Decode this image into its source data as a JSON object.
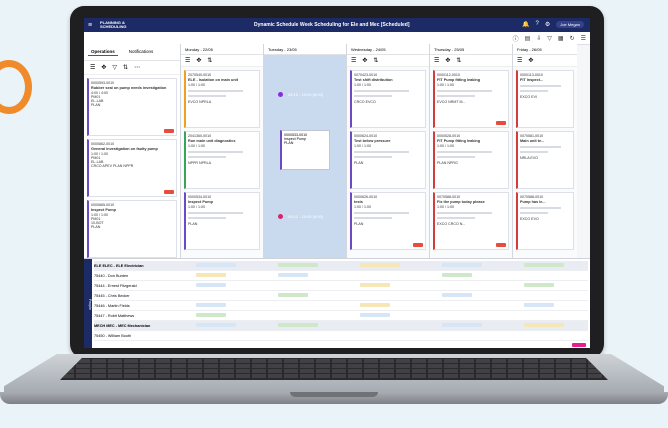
{
  "app": {
    "title": "Dynamic Schedule Week Scheduling for Ele and Mec [Scheduled]",
    "logo_line1": "PLANNING &",
    "logo_line2": "SCHEDULING",
    "user": "Joe Megan"
  },
  "left_panel": {
    "tabs": [
      "Operations",
      "Notifications"
    ],
    "cards": [
      {
        "id": "0000593-0010",
        "title": "Rubber seal on pump needs investigation",
        "hours": "4:00 / 4:00",
        "plant": "PM01",
        "workcenter": "EL-LAB",
        "tag": "PLAN"
      },
      {
        "id": "0000662-0010",
        "title": "General investigation on faulty pump",
        "hours": "1:00 / 1:00",
        "plant": "PM01",
        "workcenter": "EL-LAB",
        "tag": "CRCO APEV PLAN NPPR"
      },
      {
        "id": "0000665-0010",
        "title": "Inspect Pump",
        "hours": "1:00 / 1:00",
        "plant": "PM01",
        "workcenter": "10-BOT",
        "tag": "PLAN"
      }
    ]
  },
  "columns": [
    {
      "day": "Monday - 22/05",
      "cards": [
        {
          "id": "2070540-0010",
          "title": "ELE - Isolation on main unit",
          "hours": "1:00 / 1:00",
          "tag": "EVCO NPRLA"
        },
        {
          "id": "2041360-0010",
          "title": "Run main unit diagnostics",
          "hours": "1:00 / 1:00",
          "tag": "NPPR NPRLA"
        },
        {
          "id": "0000534-0010",
          "title": "Inspect Pump",
          "hours": "1:00 / 1:00",
          "tag": "PLAN"
        }
      ]
    },
    {
      "day": "Tuesday - 23/05",
      "drag_card": {
        "id": "0000533-0010",
        "title": "Inspect Pump",
        "tag": "PLAN"
      },
      "slots": [
        "08:12 - 10:00 (8:00)",
        "09:12 - 10:00 (8:00)"
      ]
    },
    {
      "day": "Wednesday - 24/05",
      "cards": [
        {
          "id": "0070423-0010",
          "title": "Test shift distribution",
          "hours": "1:00 / 1:00",
          "tag": "CRCO EVCO"
        },
        {
          "id": "0000624-0010",
          "title": "Test below pressure",
          "hours": "1:00 / 1:00",
          "tag": "PLAN"
        },
        {
          "id": "0000626-0010",
          "title": "tests",
          "hours": "1:00 / 1:00",
          "tag": "PLAN"
        }
      ]
    },
    {
      "day": "Thursday - 25/05",
      "cards": [
        {
          "id": "0000112-0010",
          "title": "FIT Pump fitting leaking",
          "hours": "1:00 / 1:00",
          "tag": "EVCO NRMT M..."
        },
        {
          "id": "0000528-0010",
          "title": "FIT Pump fitting leaking",
          "hours": "1:00 / 1:00",
          "tag": "PLAN NPRG"
        },
        {
          "id": "0070588-0010",
          "title": "Fix the pump today please",
          "hours": "1:00 / 1:00",
          "tag": "EXCO CRCO N..."
        }
      ]
    },
    {
      "day": "Friday - 26/05",
      "cards": [
        {
          "id": "0000113-0010",
          "title": "FIT Inspect...",
          "hours": "",
          "tag": "EXCO EVI"
        },
        {
          "id": "0070581-0010",
          "title": "Main unit te...",
          "hours": "",
          "tag": "NRLA EVO"
        },
        {
          "id": "0070588-0010",
          "title": "Pump has le...",
          "hours": "",
          "tag": "EXCO EVO"
        }
      ]
    }
  ],
  "people": {
    "tab_label": "People",
    "rows": [
      {
        "label": "ELE   ELEC - ELE Electrician",
        "group": true
      },
      {
        "label": "75440 - Don Burden",
        "group": false
      },
      {
        "label": "75444 - Ernest Fitzgerald",
        "group": false
      },
      {
        "label": "75445 - Chris Becker",
        "group": false
      },
      {
        "label": "75446 - Martin Fields",
        "group": false
      },
      {
        "label": "75447 - Robit Matthews",
        "group": false
      },
      {
        "label": "MECH   MEC - MEC Mechanician",
        "group": true
      },
      {
        "label": "75450 - William Booth",
        "group": false
      }
    ]
  },
  "colors": {
    "header": "#1c2a66",
    "accent": "#6a4bc4",
    "highlight": "#c9d9ee",
    "danger": "#e74c3c"
  }
}
